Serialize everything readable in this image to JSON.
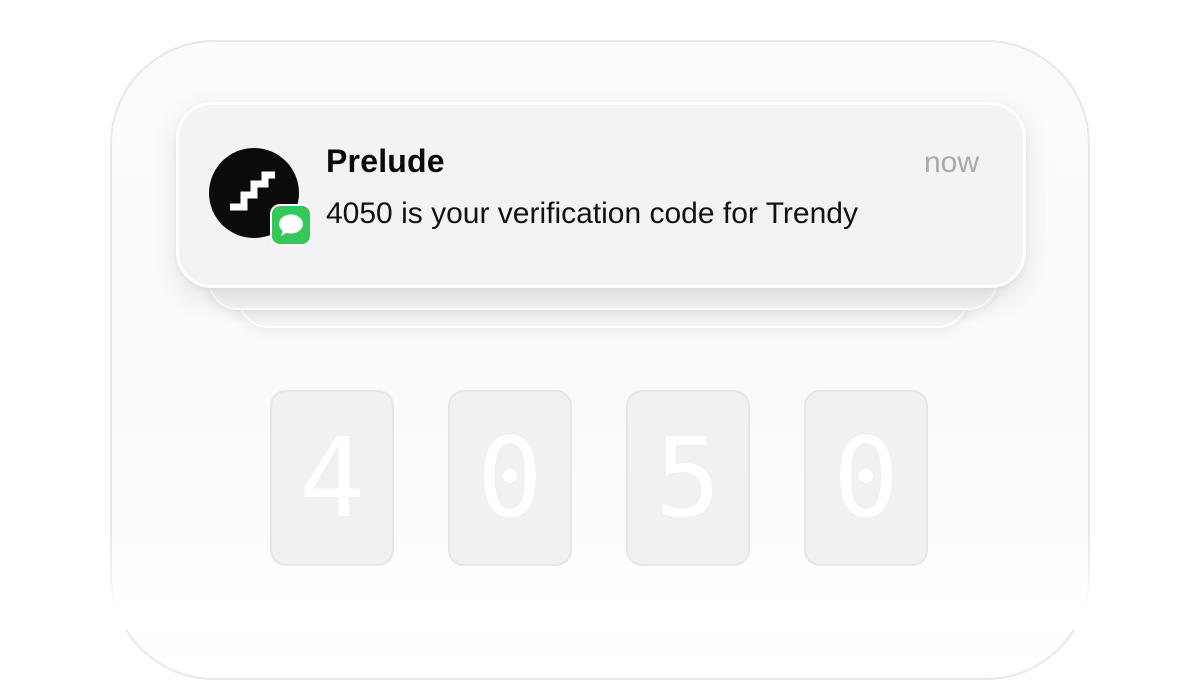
{
  "notification": {
    "sender": "Prelude",
    "timestamp": "now",
    "message": "4050 is your verification code for Trendy",
    "app_icon": "prelude-stairs-icon",
    "badge_icon": "messages-bubble-icon",
    "badge_color": "#35c759",
    "icon_bg_color": "#0b0b0b"
  },
  "otp": {
    "digits": [
      "4",
      "0",
      "5",
      "0"
    ]
  }
}
